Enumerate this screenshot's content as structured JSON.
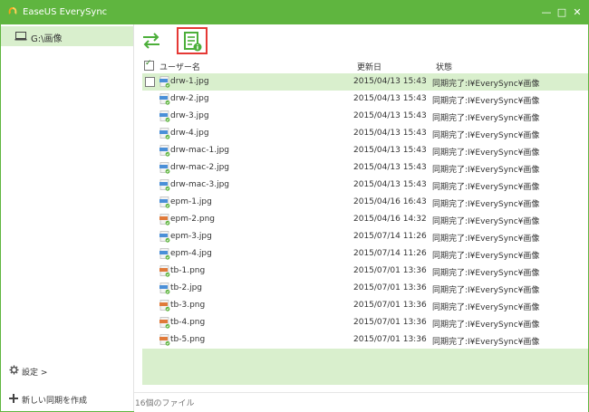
{
  "window": {
    "title": "EaseUS EverySync",
    "controls": {
      "minimize": "—",
      "maximize": "□",
      "close": "✕"
    }
  },
  "sidebar": {
    "active_item": "G:\\画像",
    "settings": "設定 >",
    "new_sync": "新しい同期を作成"
  },
  "table": {
    "headers": {
      "name": "ユーザー名",
      "date": "更新日",
      "status": "状態"
    },
    "rows": [
      {
        "name": "drw-1.jpg",
        "date": "2015/04/13 15:43",
        "status": "同期完了:I¥EverySync¥画像",
        "type": "jpg"
      },
      {
        "name": "drw-2.jpg",
        "date": "2015/04/13 15:43",
        "status": "同期完了:I¥EverySync¥画像",
        "type": "jpg"
      },
      {
        "name": "drw-3.jpg",
        "date": "2015/04/13 15:43",
        "status": "同期完了:I¥EverySync¥画像",
        "type": "jpg"
      },
      {
        "name": "drw-4.jpg",
        "date": "2015/04/13 15:43",
        "status": "同期完了:I¥EverySync¥画像",
        "type": "jpg"
      },
      {
        "name": "drw-mac-1.jpg",
        "date": "2015/04/13 15:43",
        "status": "同期完了:I¥EverySync¥画像",
        "type": "jpg"
      },
      {
        "name": "drw-mac-2.jpg",
        "date": "2015/04/13 15:43",
        "status": "同期完了:I¥EverySync¥画像",
        "type": "jpg"
      },
      {
        "name": "drw-mac-3.jpg",
        "date": "2015/04/13 15:43",
        "status": "同期完了:I¥EverySync¥画像",
        "type": "jpg"
      },
      {
        "name": "epm-1.jpg",
        "date": "2015/04/16 16:43",
        "status": "同期完了:I¥EverySync¥画像",
        "type": "jpg"
      },
      {
        "name": "epm-2.png",
        "date": "2015/04/16 14:32",
        "status": "同期完了:I¥EverySync¥画像",
        "type": "png"
      },
      {
        "name": "epm-3.jpg",
        "date": "2015/07/14 11:26",
        "status": "同期完了:I¥EverySync¥画像",
        "type": "jpg"
      },
      {
        "name": "epm-4.jpg",
        "date": "2015/07/14 11:26",
        "status": "同期完了:I¥EverySync¥画像",
        "type": "jpg"
      },
      {
        "name": "tb-1.png",
        "date": "2015/07/01 13:36",
        "status": "同期完了:I¥EverySync¥画像",
        "type": "png"
      },
      {
        "name": "tb-2.jpg",
        "date": "2015/07/01 13:36",
        "status": "同期完了:I¥EverySync¥画像",
        "type": "jpg"
      },
      {
        "name": "tb-3.png",
        "date": "2015/07/01 13:36",
        "status": "同期完了:I¥EverySync¥画像",
        "type": "png"
      },
      {
        "name": "tb-4.png",
        "date": "2015/07/01 13:36",
        "status": "同期完了:I¥EverySync¥画像",
        "type": "png"
      },
      {
        "name": "tb-5.png",
        "date": "2015/07/01 13:36",
        "status": "同期完了:I¥EverySync¥画像",
        "type": "png"
      }
    ]
  },
  "footer": {
    "file_count": "16個のファイル"
  },
  "colors": {
    "brand": "#5fb53f",
    "selection": "#d9efcd",
    "highlight": "#e53935"
  },
  "icons": {
    "logo": "easeus-logo-icon",
    "drive": "drive-icon",
    "switch": "swap-arrows-icon",
    "info": "file-info-icon",
    "settings": "gear-icon",
    "new": "plus-icon"
  }
}
